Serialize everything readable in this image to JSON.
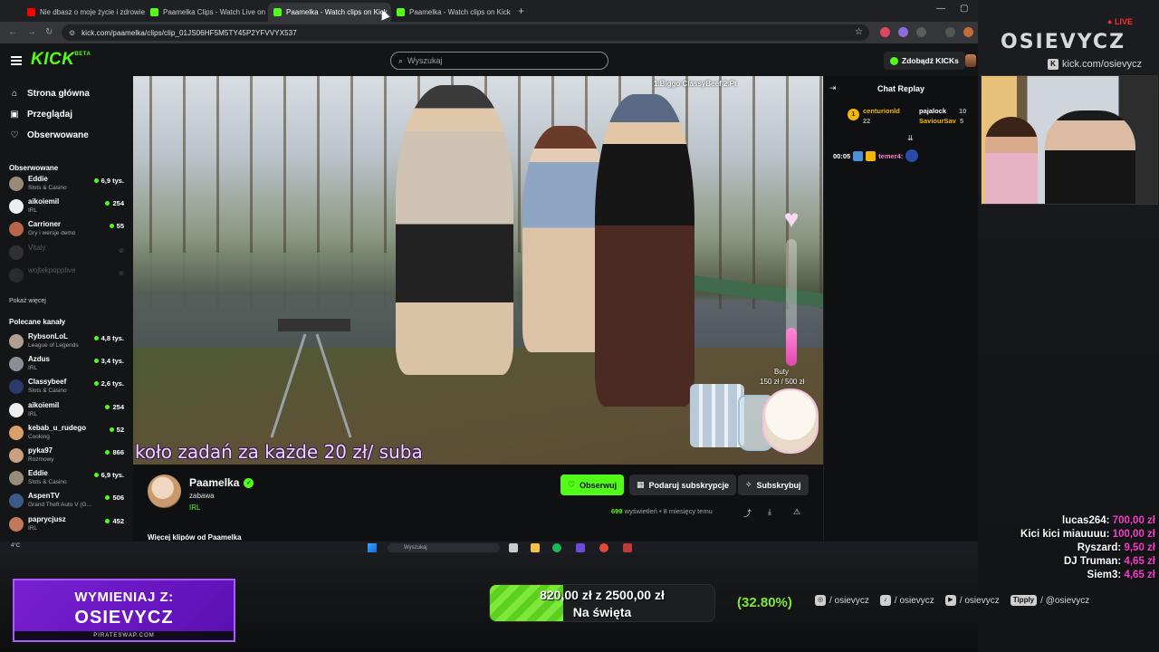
{
  "browser": {
    "tabs": [
      {
        "label": "Nie dbasz o moje życie i zdrowie",
        "fav_color": "#ff0000",
        "active": false
      },
      {
        "label": "Paamelka Clips - Watch Live on",
        "fav_color": "#53fc18",
        "active": false
      },
      {
        "label": "Paamelka - Watch clips on Kick",
        "fav_color": "#53fc18",
        "active": true
      },
      {
        "label": "Paamelka - Watch clips on Kick",
        "fav_color": "#53fc18",
        "active": false
      }
    ],
    "url": "kick.com/paamelka/clips/clip_01JS06HF5M5TY45P2YFVVYX537"
  },
  "header": {
    "logo": "KICK",
    "logo_sup": "BETA",
    "search_placeholder": "Wyszukaj",
    "kicks_button": "Zdobądź KICKs"
  },
  "sidebar": {
    "nav": [
      {
        "label": "Strona główna",
        "icon": "home-icon",
        "glyph": "⌂"
      },
      {
        "label": "Przeglądaj",
        "icon": "browse-icon",
        "glyph": "▣"
      },
      {
        "label": "Obserwowane",
        "icon": "heart-icon",
        "glyph": "♡"
      }
    ],
    "followed_title": "Obserwowane",
    "followed": [
      {
        "name": "Eddie",
        "category": "Slots & Casino",
        "viewers": "6,9 tys.",
        "color": "#9a8a7a"
      },
      {
        "name": "aikoiemil",
        "category": "IRL",
        "viewers": "254",
        "color": "#eeeeee"
      },
      {
        "name": "Carrioner",
        "category": "Gry i wersje demo",
        "viewers": "55",
        "color": "#b8654a"
      },
      {
        "name": "Vitaly",
        "category": "",
        "viewers": "",
        "color": "#666666"
      },
      {
        "name": "wojtekpopplive",
        "category": "",
        "viewers": "",
        "color": "#555555"
      }
    ],
    "show_more": "Pokaż więcej",
    "recommended_title": "Polecane kanały",
    "recommended": [
      {
        "name": "RybsonLoL",
        "category": "League of Legends",
        "viewers": "4,8 tys.",
        "color": "#b0a090"
      },
      {
        "name": "Azdus",
        "category": "IRL",
        "viewers": "3,4 tys.",
        "color": "#8a8f96"
      },
      {
        "name": "Classybeef",
        "category": "Slots & Casino",
        "viewers": "2,6 tys.",
        "color": "#2a3a6a"
      },
      {
        "name": "aikoiemil",
        "category": "IRL",
        "viewers": "254",
        "color": "#eeeeee"
      },
      {
        "name": "kebab_u_rudego",
        "category": "Cooking",
        "viewers": "52",
        "color": "#d9a06a"
      },
      {
        "name": "pyka97",
        "category": "Rozmowy",
        "viewers": "866",
        "color": "#caa080"
      },
      {
        "name": "Eddie",
        "category": "Slots & Casino",
        "viewers": "6,9 tys.",
        "color": "#9a8a7a"
      },
      {
        "name": "AspenTV",
        "category": "Grand Theft Auto V (G...",
        "viewers": "506",
        "color": "#3a5a8a"
      },
      {
        "name": "paprycjusz",
        "category": "IRL",
        "viewers": "452",
        "color": "#c07a5a"
      }
    ]
  },
  "video": {
    "ticker": "1.Biggo ClassyBeef 2.Pt",
    "goal_label": "Buty",
    "goal_amount": "150 zł / 500 zł",
    "goal_fraction": 0.3,
    "subtitle": "koło zadań za każde 20 zł/ suba"
  },
  "channel": {
    "name": "Paamelka",
    "title": "zabawa",
    "category": "IRL",
    "follow": "Obserwuj",
    "gift": "Podaruj subskrypcje",
    "subscribe": "Subskrybuj",
    "views_count": "699",
    "views_label": "wyświetleń",
    "age": "8 miesięcy temu",
    "more_clips": "Więcej klipów od Paamelka"
  },
  "chat": {
    "title": "Chat Replay",
    "top": [
      {
        "rank": "1",
        "user": "centurionld",
        "count": "22",
        "color": "#f2b705"
      },
      {
        "rank": "",
        "user": "pajalock",
        "count": "10",
        "color": "#ffffff"
      },
      {
        "rank": "",
        "user": "SaviourSav",
        "count": "5",
        "color": "#f2b705"
      }
    ],
    "line_time": "00:05",
    "line_user": "temer4:"
  },
  "taskbar": {
    "weather": "4°C",
    "search": "Wyszukaj"
  },
  "overlay": {
    "live": "LIVE",
    "brand": "OSIEVYCZ",
    "kick_link": "kick.com/osievycz",
    "donations": [
      {
        "user": "lucas264:",
        "amount": "700,00 zł"
      },
      {
        "user": "Kici kici miauuuu:",
        "amount": "100,00 zł"
      },
      {
        "user": "Ryszard:",
        "amount": "9,50 zł"
      },
      {
        "user": "DJ Truman:",
        "amount": "4,65 zł"
      },
      {
        "user": "Siem3:",
        "amount": "4,65 zł"
      }
    ],
    "swap_line1": "WYMIENIAJ Z:",
    "swap_line2": "OSIEVYCZ",
    "swap_footer": "PIRATESWAP.COM",
    "goal_text": "820,00 zł z  2500,00 zł",
    "goal_name": "Na święta",
    "goal_fraction": 0.328,
    "goal_pct": "(32.80%)",
    "socials": [
      {
        "icon": "instagram-icon",
        "glyph": "◎",
        "handle": "/ osievycz"
      },
      {
        "icon": "tiktok-icon",
        "glyph": "♪",
        "handle": "/ osievycz"
      },
      {
        "icon": "youtube-icon",
        "glyph": "▶",
        "handle": "/ osievycz"
      },
      {
        "icon": "tipply-icon",
        "glyph": "Tipply",
        "handle": "/ @osievycz"
      }
    ]
  }
}
